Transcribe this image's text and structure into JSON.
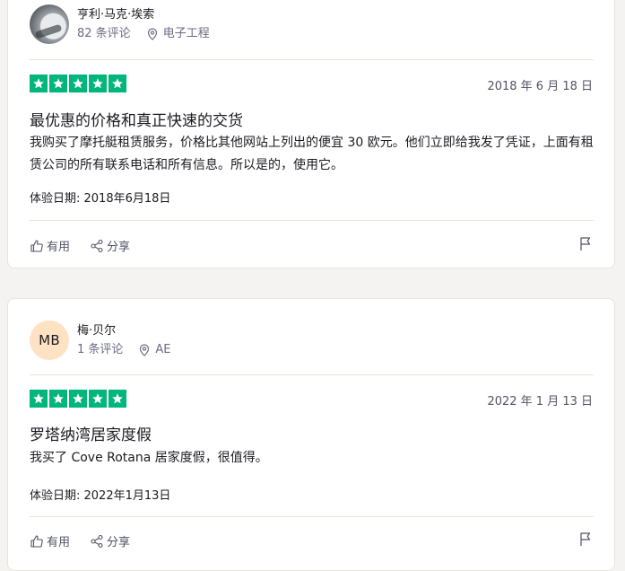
{
  "reviews": [
    {
      "consumer_name": "亨利·马克·埃索",
      "review_count": "82 条评论",
      "location": "电子工程",
      "avatar_type": "photo",
      "rating": 5,
      "date": "2018 年 6 月 18 日",
      "title": "最优惠的价格和真正快速的交货",
      "text": "我购买了摩托艇租赁服务，价格比其他网站上列出的便宜 30 欧元。他们立即给我发了凭证，上面有租赁公司的所有联系电话和所有信息。所以是的，使用它。",
      "experience_date": "体验日期: 2018年6月18日",
      "useful_label": "有用",
      "share_label": "分享"
    },
    {
      "consumer_name": "梅·贝尔",
      "initials": "MB",
      "review_count": "1 条评论",
      "location": "AE",
      "avatar_type": "initials",
      "rating": 5,
      "date": "2022 年 1 月 13 日",
      "title": "罗塔纳湾居家度假",
      "text": "我买了 Cove Rotana 居家度假，很值得。",
      "experience_date": "体验日期: 2022年1月13日",
      "useful_label": "有用",
      "share_label": "分享"
    }
  ],
  "colors": {
    "star": "#00b67a",
    "avatar_mb": "#ffe2c4"
  }
}
